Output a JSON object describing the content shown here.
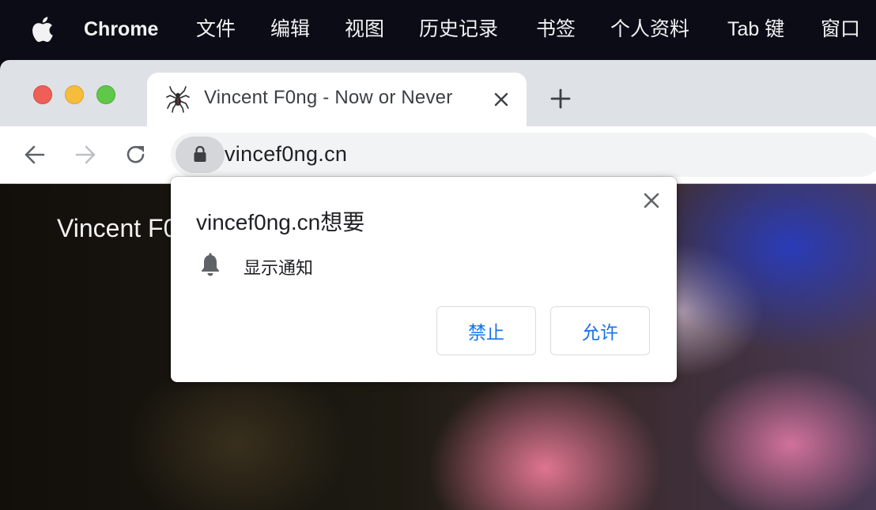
{
  "menubar": {
    "app_name": "Chrome",
    "items": [
      "文件",
      "编辑",
      "视图",
      "历史记录",
      "书签",
      "个人资料",
      "Tab 键",
      "窗口"
    ]
  },
  "tab": {
    "title": "Vincent F0ng - Now or Never",
    "favicon": "spider-icon"
  },
  "toolbar": {
    "url": "vincef0ng.cn"
  },
  "page": {
    "site_title": "Vincent F0"
  },
  "permission_dialog": {
    "heading": "vincef0ng.cn想要",
    "permission": "显示通知",
    "block_label": "禁止",
    "allow_label": "允许"
  },
  "colors": {
    "accent": "#1a73e8",
    "menubar_bg": "#0c0c16",
    "tabstrip_bg": "#dee1e6"
  }
}
